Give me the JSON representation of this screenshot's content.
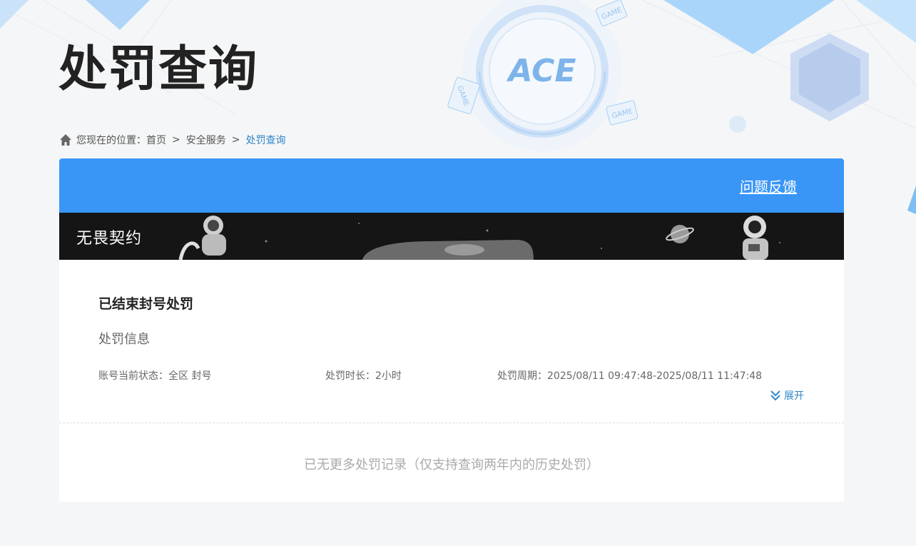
{
  "page": {
    "title": "处罚查询"
  },
  "breadcrumb": {
    "prefix": "您现在的位置：",
    "separator": ">",
    "items": [
      "首页",
      "安全服务",
      "处罚查询"
    ]
  },
  "header_logo": {
    "text": "ACE",
    "badges": [
      "GAME",
      "GAME",
      "GAME"
    ]
  },
  "card": {
    "feedback_label": "问题反馈",
    "game_name": "无畏契约",
    "record": {
      "title": "已结束封号处罚",
      "section_label": "处罚信息",
      "status_label": "账号当前状态：",
      "status_value": "全区 封号",
      "duration_label": "处罚时长：",
      "duration_value": "2小时",
      "period_label": "处罚周期：",
      "period_value": "2025/08/11 09:47:48-2025/08/11 11:47:48",
      "expand_label": "展开"
    },
    "footer_note": "已无更多处罚记录（仅支持查询两年内的历史处罚）"
  },
  "colors": {
    "accent": "#3996f7",
    "link": "#2f86c9",
    "banner_bg": "#151515"
  }
}
